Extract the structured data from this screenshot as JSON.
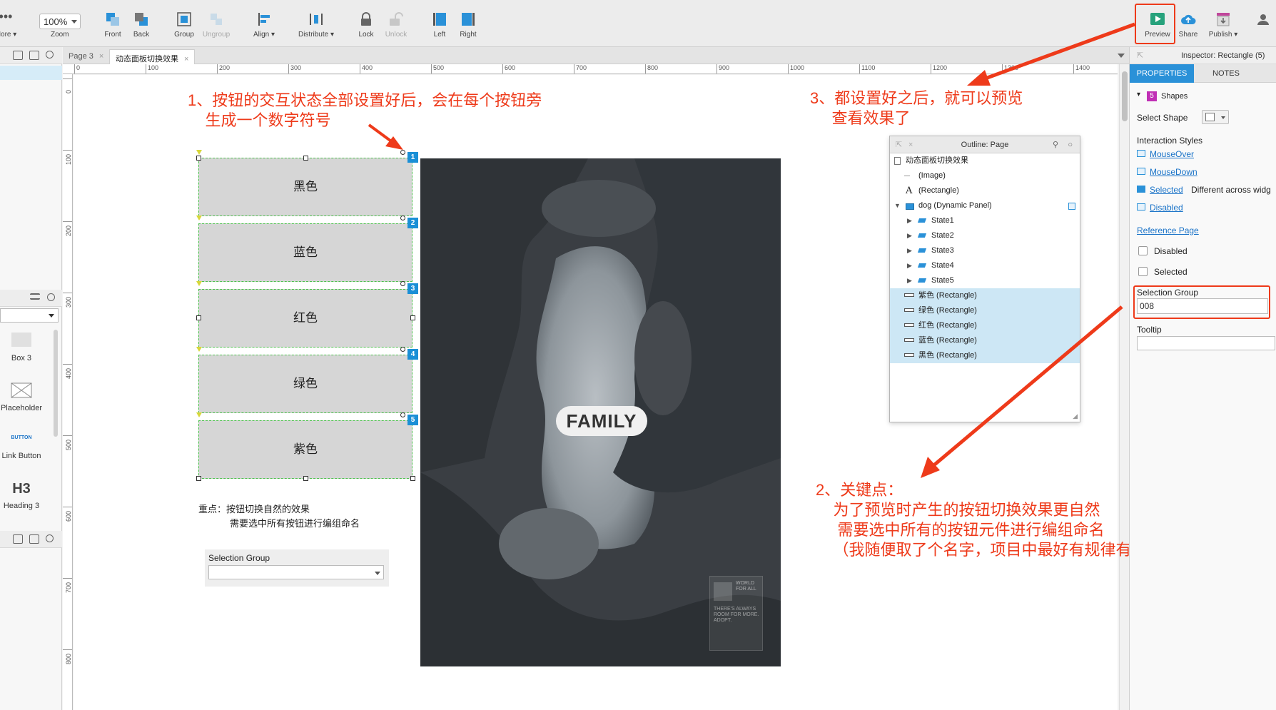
{
  "toolbar": {
    "more_label": "More",
    "zoom_value": "100%",
    "zoom_label": "Zoom",
    "front_label": "Front",
    "back_label": "Back",
    "group_label": "Group",
    "ungroup_label": "Ungroup",
    "align_label": "Align",
    "distribute_label": "Distribute",
    "lock_label": "Lock",
    "unlock_label": "Unlock",
    "left_label": "Left",
    "right_label": "Right",
    "preview_label": "Preview",
    "share_label": "Share",
    "publish_label": "Publish",
    "accent": "#1a8fd6"
  },
  "tabs": [
    {
      "label": "Page 3"
    },
    {
      "label": "动态面板切换效果"
    }
  ],
  "ruler": {
    "top": [
      "0",
      "100",
      "200",
      "300",
      "400",
      "500",
      "600",
      "700",
      "800",
      "900",
      "1000",
      "1100",
      "1200",
      "1300",
      "1400"
    ],
    "left": [
      "0",
      "100",
      "200",
      "300",
      "400",
      "500",
      "600",
      "700",
      "800"
    ]
  },
  "library": {
    "widgets": [
      {
        "label": "Box 3"
      },
      {
        "label": "Placeholder"
      },
      {
        "label": "Link Button",
        "preview": "BUTTON"
      },
      {
        "label": "Heading 3",
        "preview": "H3"
      }
    ]
  },
  "notes": {
    "note1": "1、按钮的交互状态全部设置好后，会在每个按钮旁\n    生成一个数字符号",
    "note2": "2、关键点：\n    为了预览时产生的按钮切换效果更自然\n     需要选中所有的按钮元件进行编组命名\n    （我随便取了个名字，项目中最好有规律有标记）",
    "note3": "3、都设置好之后，就可以预览\n     查看效果了",
    "color": "#ee3a1a"
  },
  "buttons": [
    {
      "label": "黑色",
      "badge": "1"
    },
    {
      "label": "蓝色",
      "badge": "2"
    },
    {
      "label": "红色",
      "badge": "3"
    },
    {
      "label": "绿色",
      "badge": "4"
    },
    {
      "label": "紫色",
      "badge": "5"
    }
  ],
  "canvas_text": {
    "key_point_line1": "重点：按钮切换自然的效果",
    "key_point_line2": "需要选中所有按钮进行编组命名",
    "selection_group_label": "Selection Group"
  },
  "poster": {
    "title": "FAMILY",
    "logo_text": "WORLD FOR ALL",
    "tagline": "THERE'S ALWAYS ROOM FOR MORE. ADOPT."
  },
  "outline": {
    "title": "Outline: Page",
    "rows": [
      {
        "label": "动态面板切换效果",
        "type": "page"
      },
      {
        "label": "(Image)",
        "type": "image"
      },
      {
        "label": "(Rectangle)",
        "type": "text"
      },
      {
        "label": "dog (Dynamic Panel)",
        "type": "panel"
      },
      {
        "label": "State1",
        "type": "state"
      },
      {
        "label": "State2",
        "type": "state"
      },
      {
        "label": "State3",
        "type": "state"
      },
      {
        "label": "State4",
        "type": "state"
      },
      {
        "label": "State5",
        "type": "state"
      },
      {
        "label": "紫色 (Rectangle)",
        "type": "rect",
        "selected": true
      },
      {
        "label": "绿色 (Rectangle)",
        "type": "rect",
        "selected": true
      },
      {
        "label": "红色 (Rectangle)",
        "type": "rect",
        "selected": true
      },
      {
        "label": "蓝色 (Rectangle)",
        "type": "rect",
        "selected": true
      },
      {
        "label": "黑色 (Rectangle)",
        "type": "rect",
        "selected": true
      }
    ]
  },
  "inspector": {
    "title": "Inspector: Rectangle (5)",
    "tab_properties": "PROPERTIES",
    "tab_notes": "NOTES",
    "shapes_count": "5",
    "shapes_label": "Shapes",
    "select_shape_label": "Select Shape",
    "interaction_styles_label": "Interaction Styles",
    "mouseover": "MouseOver",
    "mousedown": "MouseDown",
    "selected_link": "Selected",
    "selected_note": "Different across widg",
    "disabled_link": "Disabled",
    "reference_page": "Reference Page",
    "disabled_check": "Disabled",
    "selected_check": "Selected",
    "selection_group_label": "Selection Group",
    "selection_group_value": "008",
    "tooltip_label": "Tooltip"
  }
}
